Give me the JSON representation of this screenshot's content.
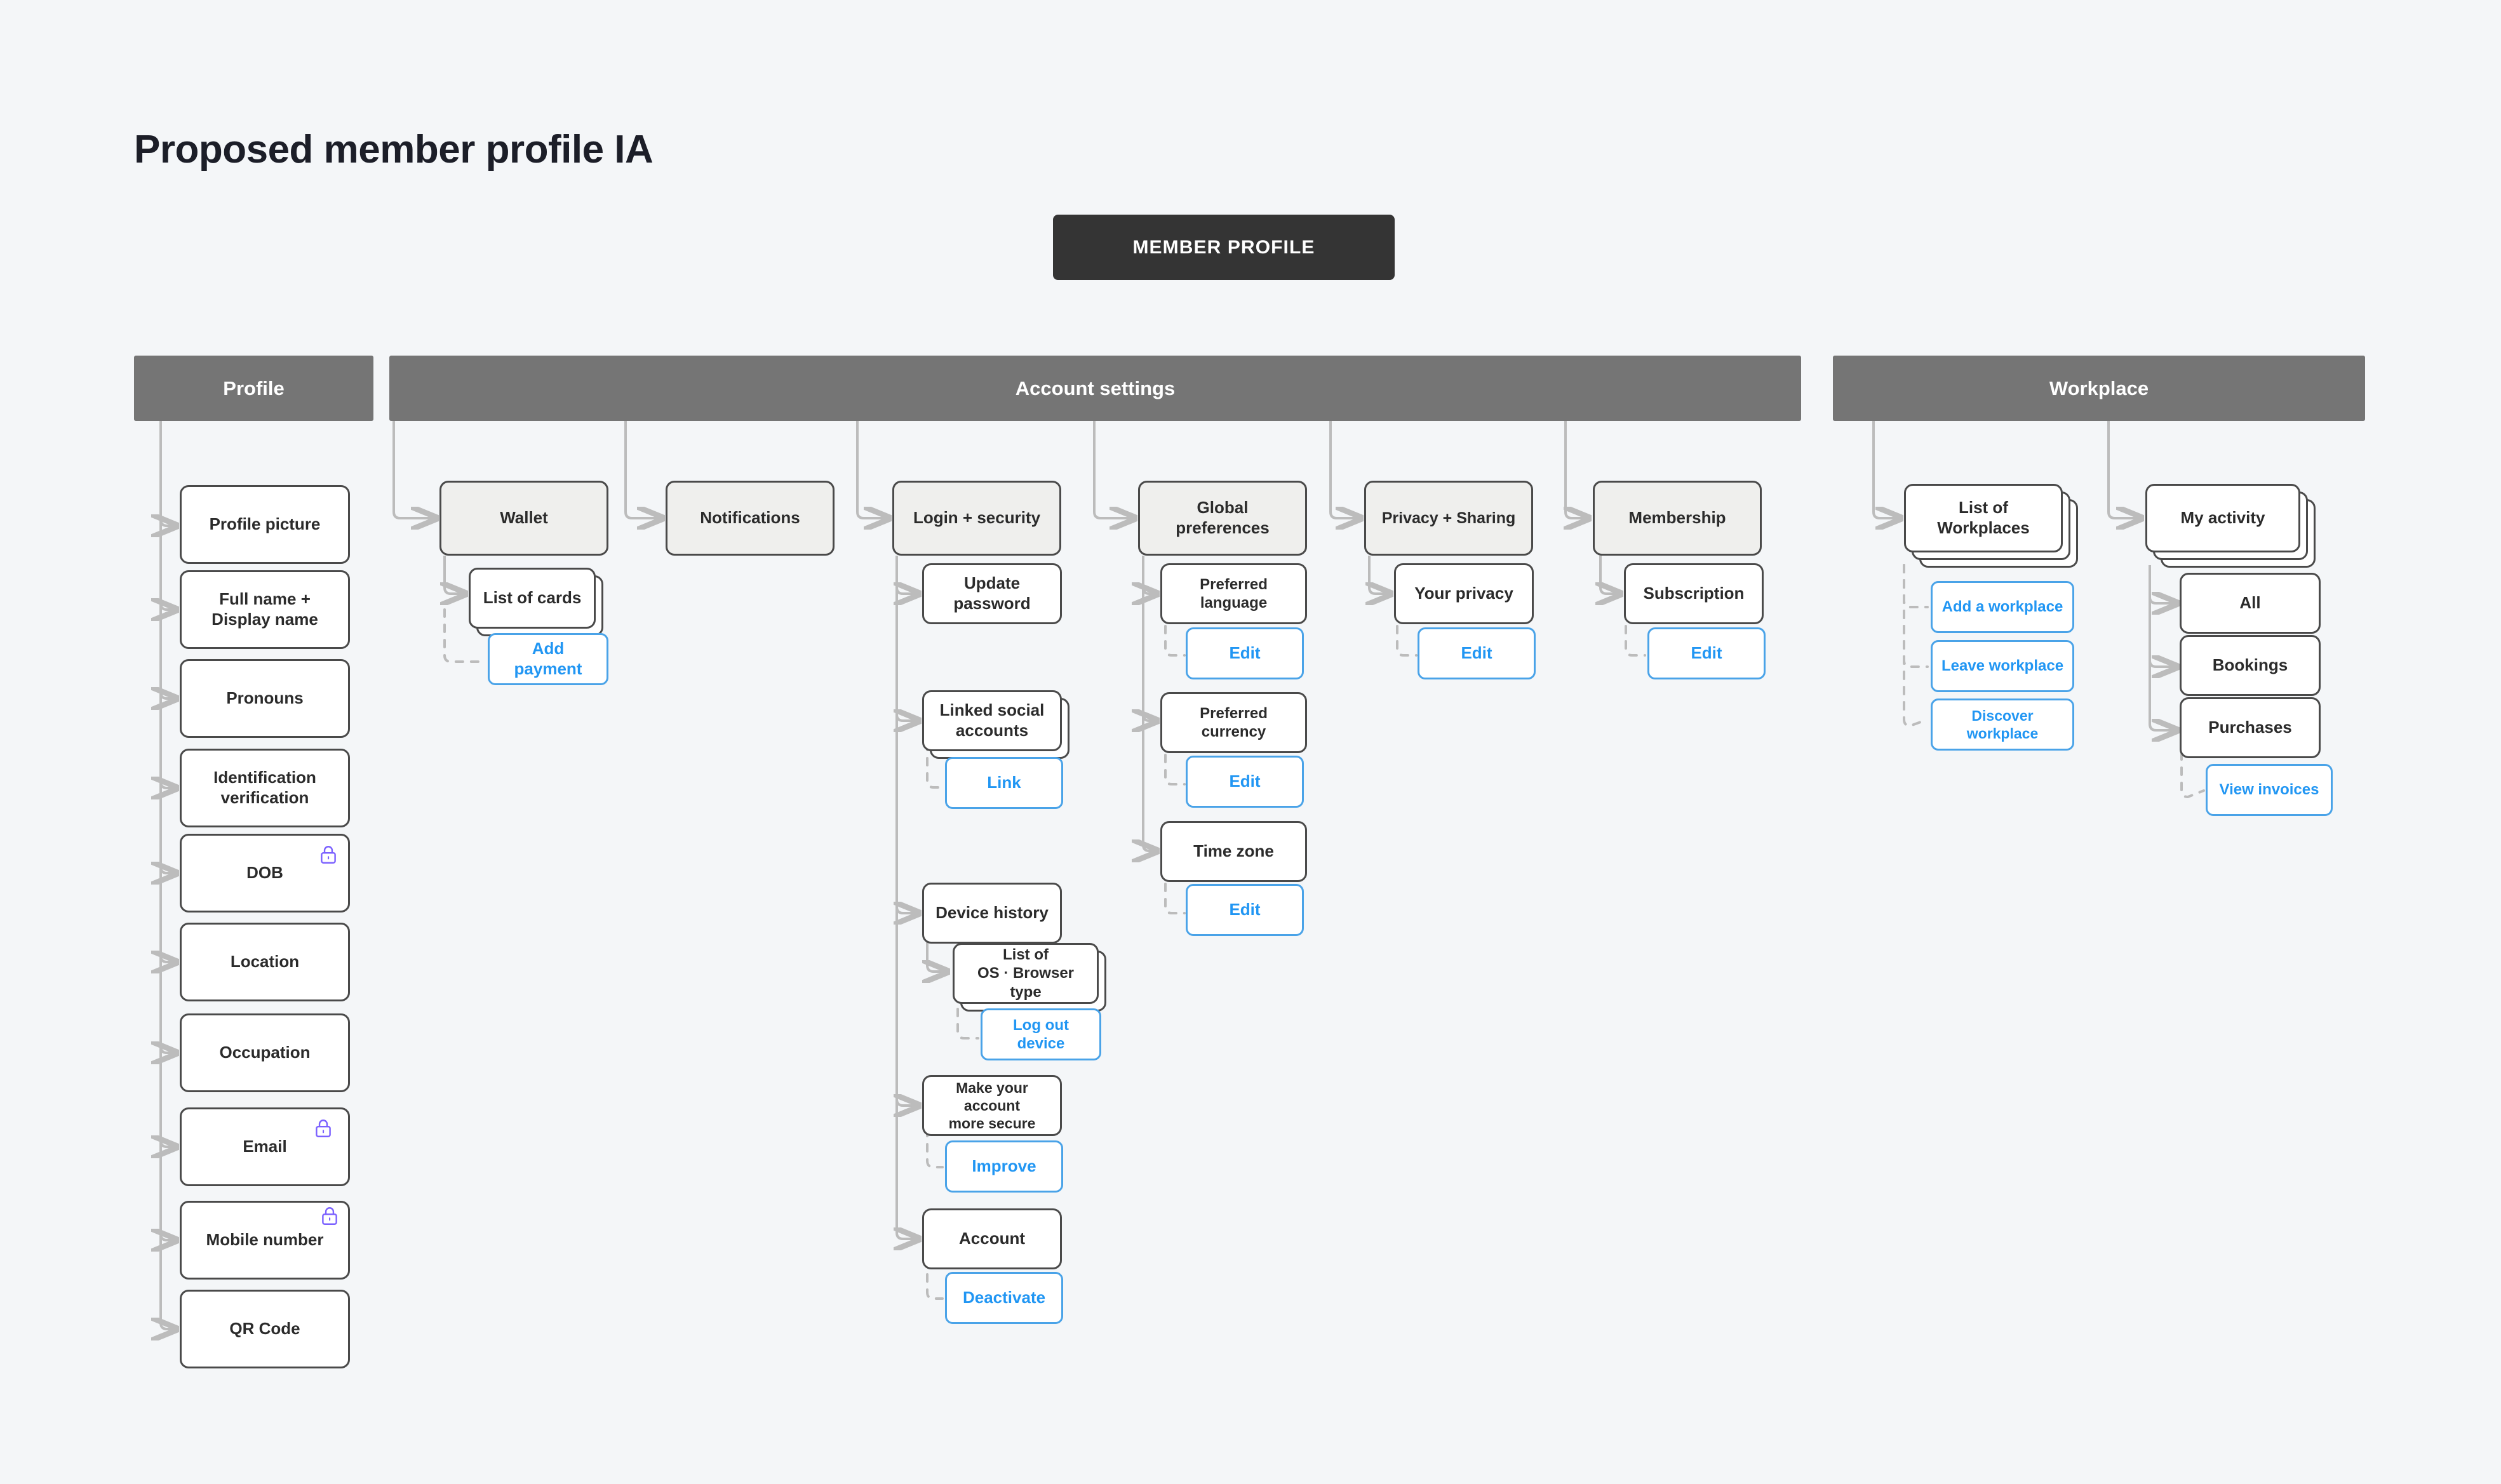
{
  "page": {
    "title": "Proposed member profile IA",
    "background_color": "#f4f6f8"
  },
  "colors": {
    "root_node": "#343434",
    "section_header": "#757575",
    "node_border": "#4a4a4a",
    "sub_head_fill": "#efefed",
    "action_border": "#4aa3e8",
    "action_text": "#2196f3",
    "lock_icon": "#7b61ff",
    "connector": "#bcbcbc"
  },
  "root": {
    "label": "MEMBER PROFILE"
  },
  "sections": [
    {
      "id": "profile",
      "label": "Profile"
    },
    {
      "id": "account_settings",
      "label": "Account settings"
    },
    {
      "id": "workplace",
      "label": "Workplace"
    }
  ],
  "profile_items": [
    {
      "label": "Profile picture",
      "locked": false
    },
    {
      "label": "Full name +\nDisplay name",
      "locked": false
    },
    {
      "label": "Pronouns",
      "locked": false
    },
    {
      "label": "Identification\nverification",
      "locked": false
    },
    {
      "label": "DOB",
      "locked": true
    },
    {
      "label": "Location",
      "locked": false
    },
    {
      "label": "Occupation",
      "locked": false
    },
    {
      "label": "Email",
      "locked": true
    },
    {
      "label": "Mobile number",
      "locked": true
    },
    {
      "label": "QR Code",
      "locked": false
    }
  ],
  "account_settings": {
    "wallet": {
      "label": "Wallet",
      "children": [
        {
          "label": "List of cards",
          "stacked": 2
        }
      ],
      "actions": [
        {
          "label": "Add payment"
        }
      ]
    },
    "notifications": {
      "label": "Notifications",
      "children": [],
      "actions": []
    },
    "login_security": {
      "label": "Login + security",
      "children": [
        {
          "label": "Update password",
          "stacked": 1,
          "actions": []
        },
        {
          "label": "Linked social\naccounts",
          "stacked": 2,
          "actions": [
            {
              "label": "Link"
            }
          ]
        },
        {
          "label": "Device history",
          "stacked": 1,
          "actions": []
        },
        {
          "label": "List of\nOS · Browser type",
          "stacked": 2,
          "actions": [
            {
              "label": "Log out device"
            }
          ]
        },
        {
          "label": "Make your account\nmore secure",
          "stacked": 1,
          "actions": [
            {
              "label": "Improve"
            }
          ]
        },
        {
          "label": "Account",
          "stacked": 1,
          "actions": [
            {
              "label": "Deactivate"
            }
          ]
        }
      ]
    },
    "global_preferences": {
      "label": "Global\npreferences",
      "children": [
        {
          "label": "Preferred language",
          "actions": [
            {
              "label": "Edit"
            }
          ]
        },
        {
          "label": "Preferred currency",
          "actions": [
            {
              "label": "Edit"
            }
          ]
        },
        {
          "label": "Time zone",
          "actions": [
            {
              "label": "Edit"
            }
          ]
        }
      ]
    },
    "privacy_sharing": {
      "label": "Privacy + Sharing",
      "children": [
        {
          "label": "Your privacy",
          "actions": [
            {
              "label": "Edit"
            }
          ]
        }
      ]
    },
    "membership": {
      "label": "Membership",
      "children": [
        {
          "label": "Subscription",
          "actions": [
            {
              "label": "Edit"
            }
          ]
        }
      ]
    }
  },
  "workplace": {
    "list_of_workplaces": {
      "label": "List of\nWorkplaces",
      "stacked": 3,
      "actions": [
        {
          "label": "Add a workplace"
        },
        {
          "label": "Leave workplace"
        },
        {
          "label": "Discover workplace"
        }
      ]
    },
    "my_activity": {
      "label": "My activity",
      "stacked": 3,
      "children": [
        {
          "label": "All",
          "actions": []
        },
        {
          "label": "Bookings",
          "actions": []
        },
        {
          "label": "Purchases",
          "actions": [
            {
              "label": "View invoices"
            }
          ]
        }
      ]
    }
  }
}
